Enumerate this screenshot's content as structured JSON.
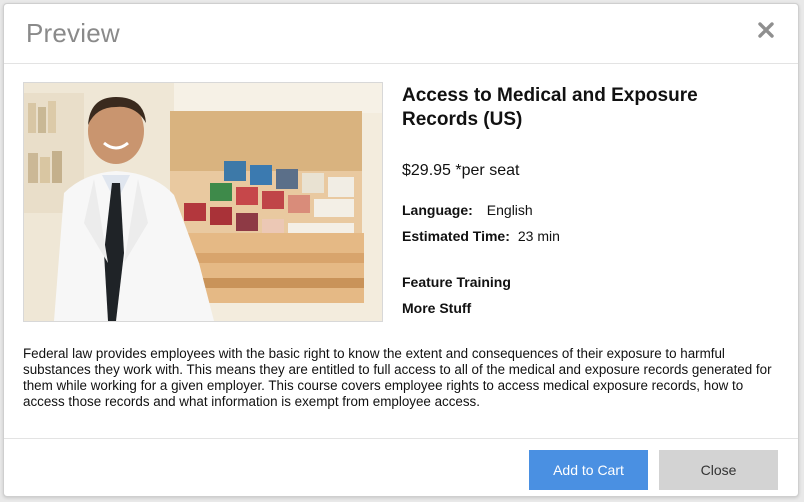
{
  "modal": {
    "title": "Preview",
    "close_icon": "close-icon"
  },
  "product": {
    "title": "Access to Medical and Exposure Records (US)",
    "price": "$29.95",
    "price_suffix": "*per seat",
    "language_label": "Language:",
    "language_value": "English",
    "time_label": "Estimated Time:",
    "time_value": "23 min",
    "features": [
      "Feature Training",
      "More Stuff"
    ],
    "description": "Federal law provides employees with the basic right to know the extent and consequences of their exposure to harmful substances they work with. This means they are entitled to full access to all of the medical and exposure records generated for them while working for a given employer. This course covers employee rights to access medical exposure records, how to access those records and what information is exempt from employee access."
  },
  "footer": {
    "add_to_cart_label": "Add to Cart",
    "close_label": "Close"
  },
  "colors": {
    "primary_button": "#4a90e2",
    "secondary_button": "#d3d3d3",
    "title_gray": "#8a8a8a"
  }
}
